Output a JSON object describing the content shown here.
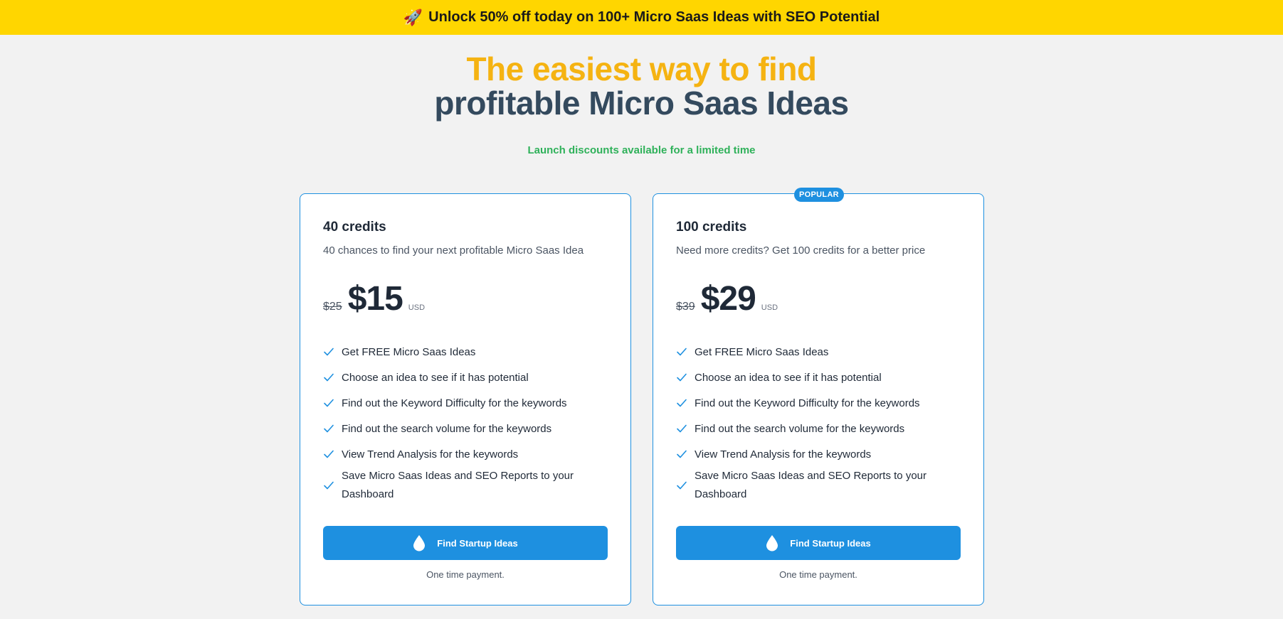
{
  "banner": {
    "icon": "rocket-icon",
    "text": "Unlock 50% off today on 100+ Micro Saas Ideas with SEO Potential",
    "background": "#ffd600"
  },
  "hero": {
    "line1": "The easiest way to find",
    "line2": "profitable Micro Saas Ideas",
    "subtitle": "Launch discounts available for a limited time",
    "accent_color": "#f5b312",
    "subtitle_color": "#2fb15a"
  },
  "plans": [
    {
      "title": "40 credits",
      "description": "40 chances to find your next profitable Micro Saas Idea",
      "old_price": "$25",
      "price": "$15",
      "currency": "USD",
      "features": [
        "Get FREE Micro Saas Ideas",
        "Choose an idea to see if it has potential",
        "Find out the Keyword Difficulty for the keywords",
        "Find out the search volume for the keywords",
        "View Trend Analysis for the keywords",
        "Save Micro Saas Ideas and SEO Reports to your Dashboard"
      ],
      "button": "Find Startup Ideas",
      "note": "One time payment."
    },
    {
      "badge": "POPULAR",
      "title": "100 credits",
      "description": "Need more credits? Get 100 credits for a better price",
      "old_price": "$39",
      "price": "$29",
      "currency": "USD",
      "features": [
        "Get FREE Micro Saas Ideas",
        "Choose an idea to see if it has potential",
        "Find out the Keyword Difficulty for the keywords",
        "Find out the search volume for the keywords",
        "View Trend Analysis for the keywords",
        "Save Micro Saas Ideas and SEO Reports to your Dashboard"
      ],
      "button": "Find Startup Ideas",
      "note": "One time payment."
    }
  ],
  "colors": {
    "primary": "#1e90e0",
    "heading_dark": "#344a5e"
  }
}
